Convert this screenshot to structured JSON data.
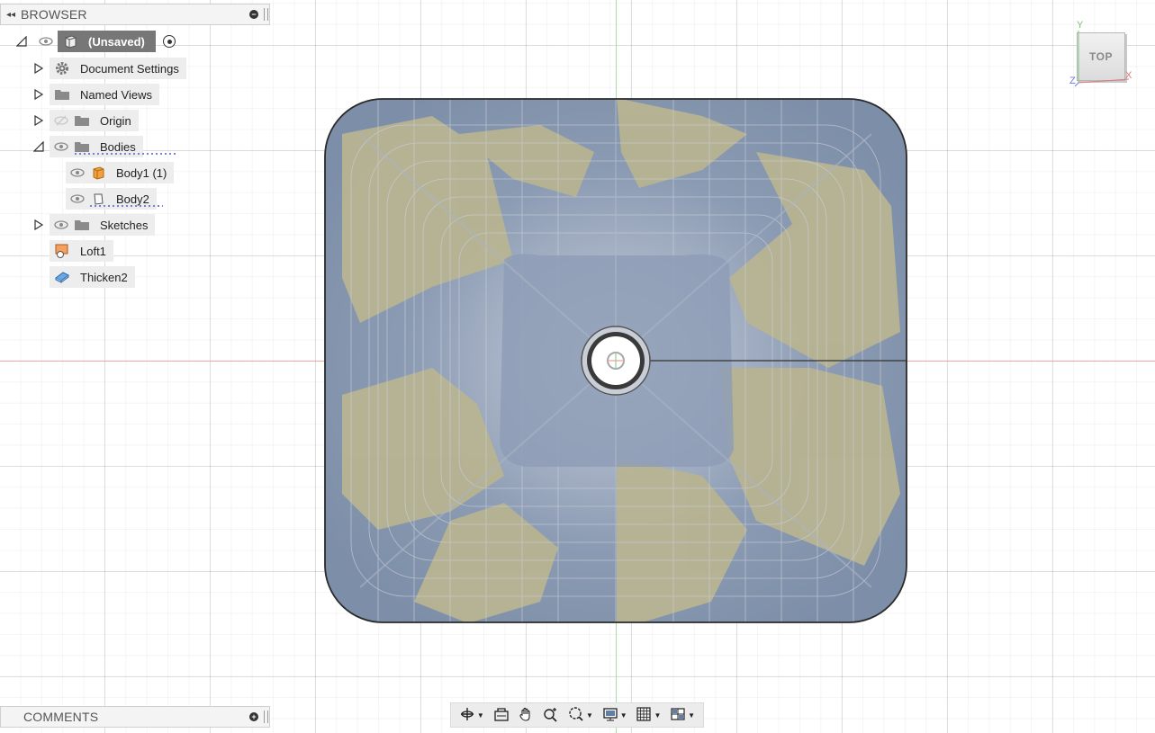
{
  "browser": {
    "title": "BROWSER",
    "root": {
      "label": "(Unsaved)"
    },
    "items": [
      {
        "label": "Document Settings",
        "icon": "gear-icon"
      },
      {
        "label": "Named Views",
        "icon": "folder-icon"
      },
      {
        "label": "Origin",
        "icon": "folder-icon"
      },
      {
        "label": "Bodies",
        "icon": "folder-icon"
      },
      {
        "label": "Body1 (1)",
        "icon": "body-icon"
      },
      {
        "label": "Body2",
        "icon": "body-icon"
      },
      {
        "label": "Sketches",
        "icon": "folder-icon"
      },
      {
        "label": "Loft1",
        "icon": "loft-icon"
      },
      {
        "label": "Thicken2",
        "icon": "thicken-icon"
      }
    ]
  },
  "comments": {
    "title": "COMMENTS"
  },
  "viewcube": {
    "face": "TOP",
    "axis_y": "Y",
    "axis_x": "X",
    "axis_z": "Z"
  },
  "colors": {
    "model_blue": "#8d9fb8",
    "model_tan": "#b8b492",
    "axis_red": "#f3a6a6",
    "axis_green": "#a6e0a6"
  },
  "toolbar": {
    "tools": [
      "orbit-icon",
      "look-at-icon",
      "pan-icon",
      "zoom-icon",
      "fit-icon",
      "display-settings-icon",
      "grid-settings-icon",
      "viewports-icon"
    ]
  }
}
